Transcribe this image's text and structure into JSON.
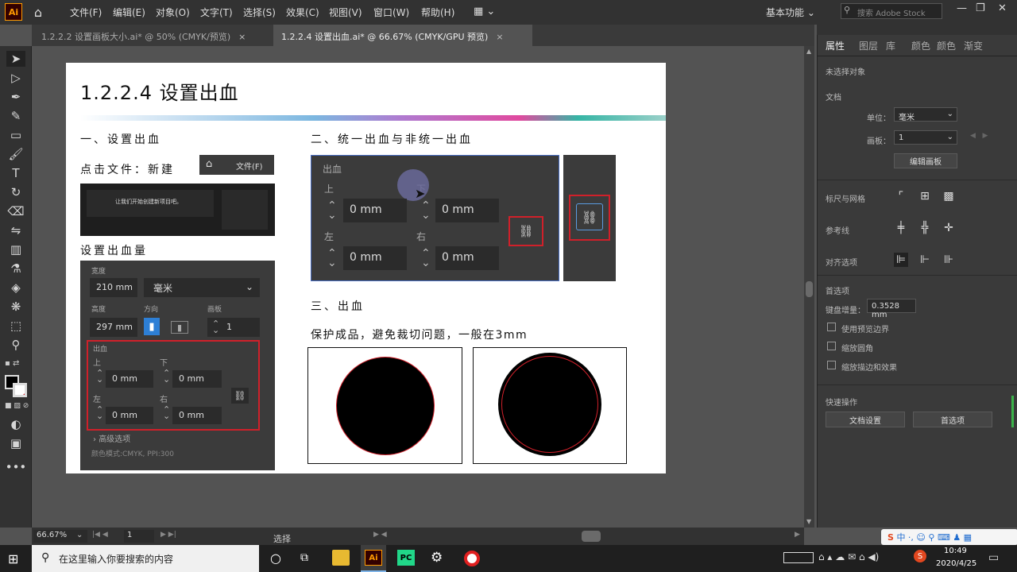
{
  "app": {
    "logo": "Ai"
  },
  "menu": [
    "文件(F)",
    "编辑(E)",
    "对象(O)",
    "文字(T)",
    "选择(S)",
    "效果(C)",
    "视图(V)",
    "窗口(W)",
    "帮助(H)"
  ],
  "workspace": "基本功能",
  "stock_search_placeholder": "搜索 Adobe Stock",
  "tabs": [
    {
      "label": "1.2.2.2  设置画板大小.ai* @ 50% (CMYK/预览)",
      "close": "×",
      "active": false
    },
    {
      "label": "1.2.2.4  设置出血.ai* @ 66.67% (CMYK/GPU 预览)",
      "close": "×",
      "active": true
    }
  ],
  "artboard": {
    "title": "1.2.2.4 设置出血",
    "sec1_heading": "一、设置出血",
    "sec1_step": "点击文件：新建",
    "mini_menu_label": "文件(F)",
    "mini_dialog_text": "让我们开始创建新项目吧。",
    "sec1_sub": "设置出血量",
    "doc_panel": {
      "width_label": "宽度",
      "width_value": "210 mm",
      "unit_value": "毫米",
      "height_label": "高度",
      "height_value": "297 mm",
      "orientation_label": "方向",
      "artboards_label": "画板",
      "artboards_value": "1",
      "bleed_label": "出血",
      "top_label": "上",
      "bottom_label": "下",
      "left_label": "左",
      "right_label": "右",
      "top_value": "0 mm",
      "bottom_value": "0 mm",
      "left_value": "0 mm",
      "right_value": "0 mm",
      "advanced_label": "高级选项",
      "color_mode_text": "颜色模式:CMYK, PPI:300"
    },
    "sec2_heading": "二、统一出血与非统一出血",
    "bleed_panel": {
      "label": "出血",
      "top_label": "上",
      "bottom_label": "下",
      "left_label": "左",
      "right_label": "右",
      "top_value": "0 mm",
      "bottom_value": "0 mm",
      "left_value": "0 mm",
      "right_value": "0 mm"
    },
    "sec3_heading": "三、出血",
    "sec3_desc": "保护成品，避免裁切问题，一般在3mm"
  },
  "right_panel": {
    "tabs": [
      "属性",
      "图层",
      "库",
      "颜色",
      "颜色",
      "渐变"
    ],
    "no_selection": "未选择对象",
    "document_section": "文档",
    "unit_label": "单位：",
    "unit_value": "毫米",
    "artboard_label": "画板：",
    "artboard_value": "1",
    "edit_artboard_button": "编辑画板",
    "ruler_grid_label": "标尺与网格",
    "guides_label": "参考线",
    "align_label": "对齐选项",
    "preferences_section": "首选项",
    "keyboard_increment_label": "键盘增量：",
    "keyboard_increment_value": "0.3528 mm",
    "checkboxes": [
      "使用预览边界",
      "缩放圆角",
      "缩放描边和效果"
    ],
    "quick_actions_section": "快速操作",
    "doc_setup_button": "文档设置",
    "preferences_button": "首选项"
  },
  "status": {
    "zoom": "66.67%",
    "artboard_num": "1",
    "tool": "选择"
  },
  "taskbar": {
    "search_placeholder": "在这里输入你要搜索的内容",
    "ime": "中",
    "time": "10:49",
    "date": "2020/4/25"
  },
  "colors": {
    "accent_red": "#d0202a",
    "bleed_line": "#d0202a",
    "ai_orange": "#ff9a00"
  }
}
